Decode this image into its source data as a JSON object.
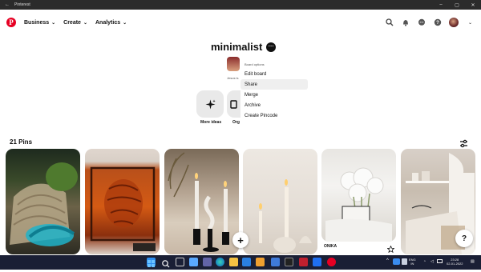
{
  "window": {
    "title": "Pinterest",
    "back_icon": "back-arrow-icon",
    "controls": [
      "minimize-icon",
      "maximize-icon",
      "close-icon"
    ]
  },
  "nav": {
    "logo": "pinterest-logo",
    "business_label": "Business",
    "create_label": "Create",
    "analytics_label": "Analytics",
    "right_icons": [
      "search-icon",
      "bell-icon",
      "message-icon",
      "help-icon"
    ]
  },
  "board": {
    "title": "minimalist",
    "more_label": "···",
    "collaborator_caption": "Jesus is"
  },
  "menu": {
    "header": "Board options",
    "items": [
      "Edit board",
      "Share",
      "Merge",
      "Archive",
      "Create Pincode"
    ],
    "highlighted": "Share"
  },
  "actions": {
    "more_ideas_label": "More ideas",
    "organise_label": "Org"
  },
  "pins": {
    "count_label": "21 Pins",
    "cards": [
      {
        "desc": "sculpture"
      },
      {
        "desc": "string art"
      },
      {
        "desc": "candles"
      },
      {
        "desc": "candles"
      },
      {
        "desc": "flowers",
        "name": "ONIKA"
      },
      {
        "desc": "shelves"
      }
    ]
  },
  "fab_label": "+",
  "help_label": "?",
  "taskbar": {
    "lang_top": "ENG",
    "lang_bottom": "IN",
    "time": "23:28",
    "date": "02-01-2022"
  },
  "colors": {
    "brand": "#e60023",
    "taskbar": "#1a1f35",
    "menu_highlight": "#efefef"
  }
}
